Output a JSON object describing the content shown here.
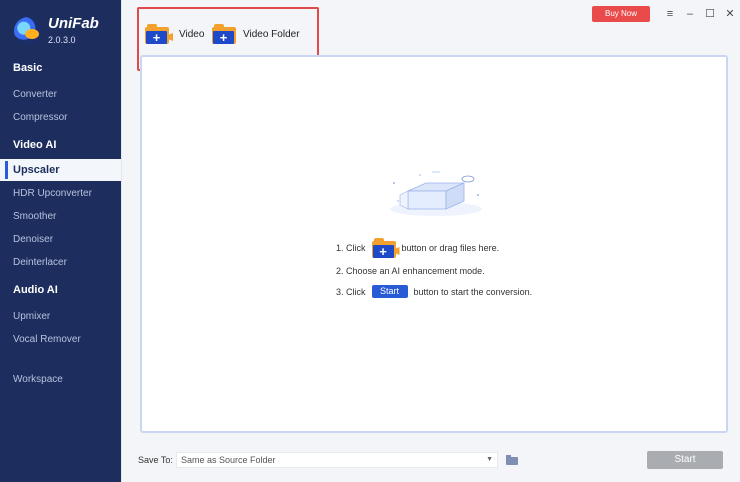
{
  "app": {
    "name": "UniFab",
    "version": "2.0.3.0"
  },
  "sidebar": {
    "groups": [
      {
        "label": "Basic",
        "items": [
          "Converter",
          "Compressor"
        ]
      },
      {
        "label": "Video AI",
        "items": [
          "Upscaler",
          "HDR Upconverter",
          "Smoother",
          "Denoiser",
          "Deinterlacer"
        ]
      },
      {
        "label": "Audio AI",
        "items": [
          "Upmixer",
          "Vocal Remover"
        ]
      }
    ],
    "active": "Upscaler",
    "workspace": "Workspace"
  },
  "toolbar": {
    "video_label": "Video",
    "folder_label": "Video Folder"
  },
  "window": {
    "buy_label": "Buy Now",
    "menu_icon": "≡",
    "min_icon": "–",
    "max_icon": "☐",
    "close_icon": "✕"
  },
  "steps": {
    "s1_prefix": "1. Click",
    "s1_suffix": "button or drag files here.",
    "s2": "2. Choose an AI enhancement mode.",
    "s3_prefix": "3. Click",
    "s3_chip": "Start",
    "s3_suffix": "button to start the conversion."
  },
  "footer": {
    "save_label": "Save To:",
    "save_value": "Same as Source Folder",
    "start_label": "Start"
  },
  "colors": {
    "sidebar": "#1c2d5e",
    "accent": "#2a5bd7",
    "buy": "#e94b4b"
  }
}
